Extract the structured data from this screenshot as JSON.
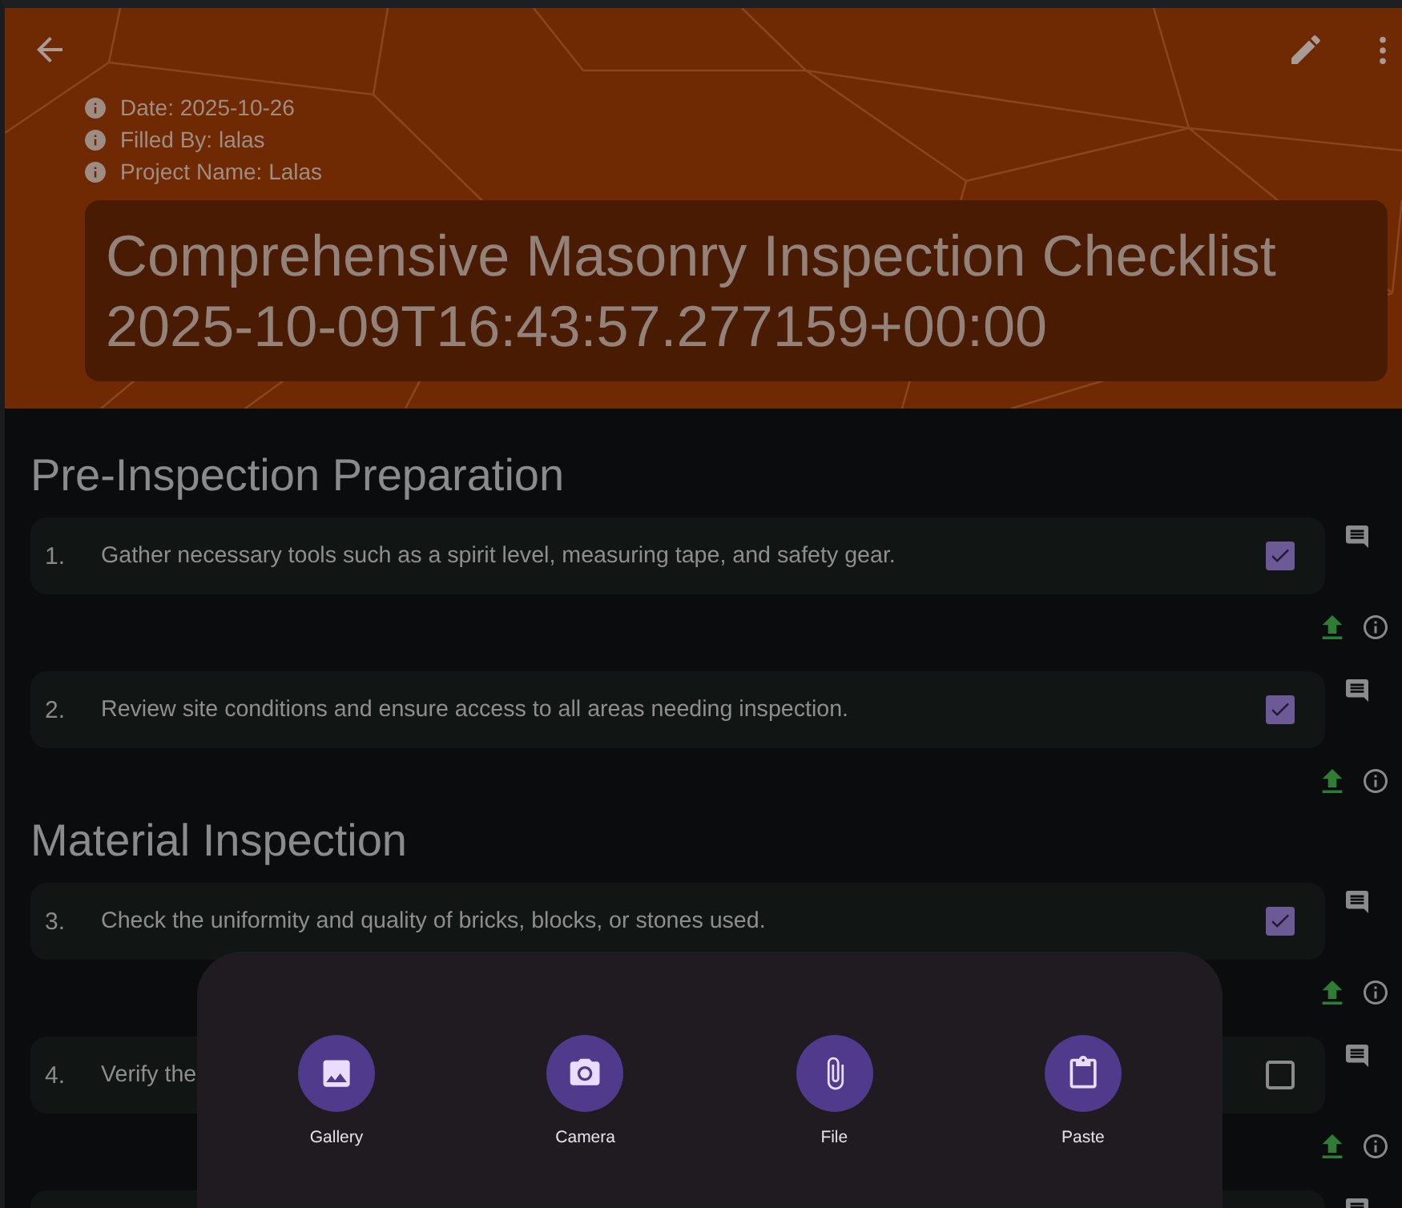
{
  "header": {
    "details": [
      "Date: 2025-10-26",
      "Filled By: lalas",
      "Project Name: Lalas"
    ],
    "title": "Comprehensive Masonry Inspection Checklist 2025-10-09T16:43:57.277159+00:00"
  },
  "sections": [
    {
      "title": "Pre-Inspection Preparation",
      "items": [
        {
          "kind": "task",
          "number": "1.",
          "text": "Gather necessary tools such as a spirit level, measuring tape, and safety gear.",
          "checked": true
        },
        {
          "kind": "task",
          "number": "2.",
          "text": "Review site conditions and ensure access to all areas needing inspection.",
          "checked": true
        }
      ]
    },
    {
      "title": "Material Inspection",
      "items": [
        {
          "kind": "task",
          "number": "3.",
          "text": "Check the uniformity and quality of bricks, blocks, or stones used.",
          "checked": true
        },
        {
          "kind": "task",
          "number": "4.",
          "text": "Verify the",
          "checked": false
        },
        {
          "kind": "cut_off"
        }
      ]
    }
  ],
  "attachment_sheet": {
    "options": [
      {
        "kind": "gallery",
        "label": "Gallery"
      },
      {
        "kind": "camera",
        "label": "Camera"
      },
      {
        "kind": "file",
        "label": "File"
      },
      {
        "kind": "paste",
        "label": "Paste"
      }
    ]
  }
}
